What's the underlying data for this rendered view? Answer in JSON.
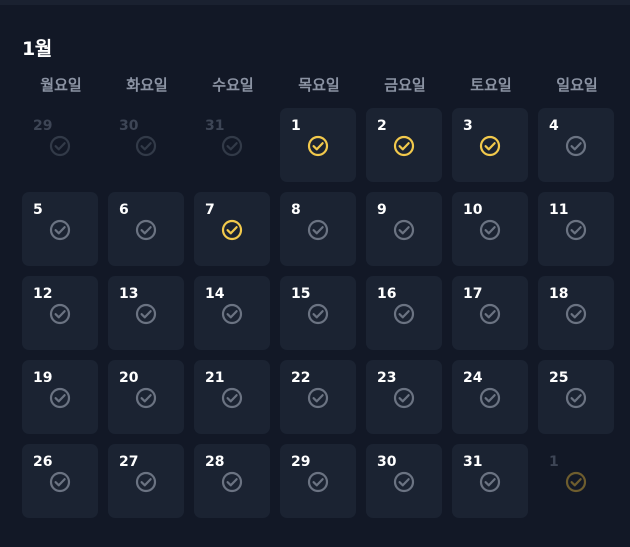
{
  "calendar": {
    "month_label": "1월",
    "weekdays": [
      "월요일",
      "화요일",
      "수요일",
      "목요일",
      "금요일",
      "토요일",
      "일요일"
    ],
    "colors": {
      "checked": "#f2c94c",
      "unchecked": "#6b7382",
      "outside_unchecked": "#323a48",
      "outside_next": "#6e5d2e"
    },
    "days": [
      {
        "label": "29",
        "in_month": false,
        "checked": false,
        "icon": "check-circle-icon"
      },
      {
        "label": "30",
        "in_month": false,
        "checked": false,
        "icon": "check-circle-icon"
      },
      {
        "label": "31",
        "in_month": false,
        "checked": false,
        "icon": "check-circle-icon"
      },
      {
        "label": "1",
        "in_month": true,
        "checked": true,
        "icon": "check-circle-icon"
      },
      {
        "label": "2",
        "in_month": true,
        "checked": true,
        "icon": "check-circle-icon"
      },
      {
        "label": "3",
        "in_month": true,
        "checked": true,
        "icon": "check-circle-icon"
      },
      {
        "label": "4",
        "in_month": true,
        "checked": false,
        "icon": "check-circle-icon"
      },
      {
        "label": "5",
        "in_month": true,
        "checked": false,
        "icon": "check-circle-icon"
      },
      {
        "label": "6",
        "in_month": true,
        "checked": false,
        "icon": "check-circle-icon"
      },
      {
        "label": "7",
        "in_month": true,
        "checked": true,
        "icon": "check-circle-icon"
      },
      {
        "label": "8",
        "in_month": true,
        "checked": false,
        "icon": "check-circle-icon"
      },
      {
        "label": "9",
        "in_month": true,
        "checked": false,
        "icon": "check-circle-icon"
      },
      {
        "label": "10",
        "in_month": true,
        "checked": false,
        "icon": "check-circle-icon"
      },
      {
        "label": "11",
        "in_month": true,
        "checked": false,
        "icon": "check-circle-icon"
      },
      {
        "label": "12",
        "in_month": true,
        "checked": false,
        "icon": "check-circle-icon"
      },
      {
        "label": "13",
        "in_month": true,
        "checked": false,
        "icon": "check-circle-icon"
      },
      {
        "label": "14",
        "in_month": true,
        "checked": false,
        "icon": "check-circle-icon"
      },
      {
        "label": "15",
        "in_month": true,
        "checked": false,
        "icon": "check-circle-icon"
      },
      {
        "label": "16",
        "in_month": true,
        "checked": false,
        "icon": "check-circle-icon"
      },
      {
        "label": "17",
        "in_month": true,
        "checked": false,
        "icon": "check-circle-icon"
      },
      {
        "label": "18",
        "in_month": true,
        "checked": false,
        "icon": "check-circle-icon"
      },
      {
        "label": "19",
        "in_month": true,
        "checked": false,
        "icon": "check-circle-icon"
      },
      {
        "label": "20",
        "in_month": true,
        "checked": false,
        "icon": "check-circle-icon"
      },
      {
        "label": "21",
        "in_month": true,
        "checked": false,
        "icon": "check-circle-icon"
      },
      {
        "label": "22",
        "in_month": true,
        "checked": false,
        "icon": "check-circle-icon"
      },
      {
        "label": "23",
        "in_month": true,
        "checked": false,
        "icon": "check-circle-icon"
      },
      {
        "label": "24",
        "in_month": true,
        "checked": false,
        "icon": "check-circle-icon"
      },
      {
        "label": "25",
        "in_month": true,
        "checked": false,
        "icon": "check-circle-icon"
      },
      {
        "label": "26",
        "in_month": true,
        "checked": false,
        "icon": "check-circle-icon"
      },
      {
        "label": "27",
        "in_month": true,
        "checked": false,
        "icon": "check-circle-icon"
      },
      {
        "label": "28",
        "in_month": true,
        "checked": false,
        "icon": "check-circle-icon"
      },
      {
        "label": "29",
        "in_month": true,
        "checked": false,
        "icon": "check-circle-icon"
      },
      {
        "label": "30",
        "in_month": true,
        "checked": false,
        "icon": "check-circle-icon"
      },
      {
        "label": "31",
        "in_month": true,
        "checked": false,
        "icon": "check-circle-icon"
      },
      {
        "label": "1",
        "in_month": false,
        "checked": false,
        "next_month": true,
        "icon": "check-circle-icon"
      }
    ]
  }
}
